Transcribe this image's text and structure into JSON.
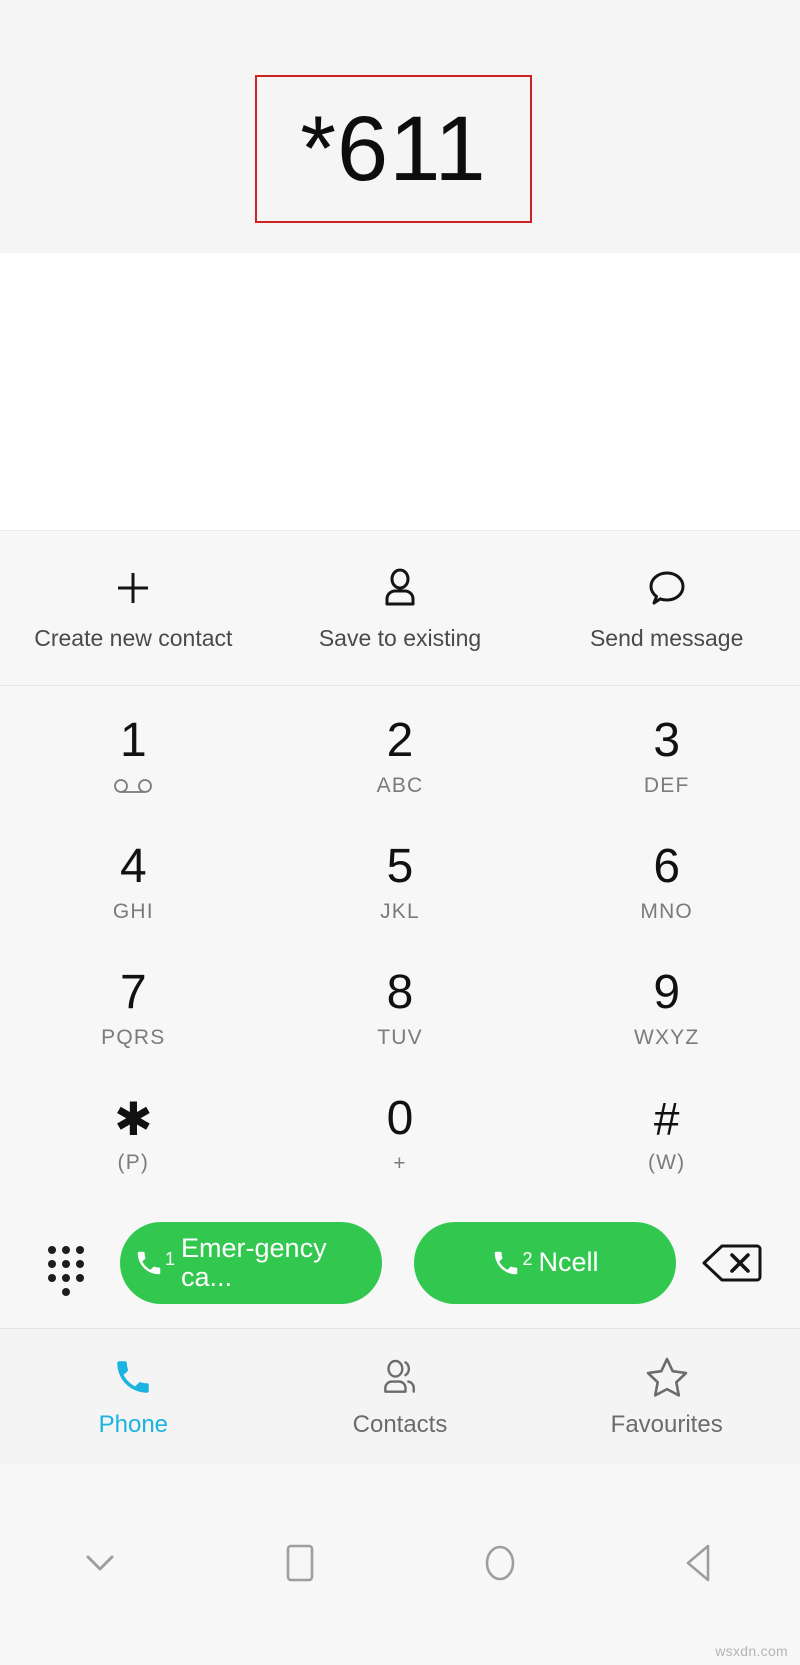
{
  "header": {
    "dialed_number": "*611",
    "highlight_color": "#cc2222",
    "background": "#f5f5f5"
  },
  "actions": [
    {
      "label": "Create new contact",
      "icon": "plus-icon"
    },
    {
      "label": "Save to existing",
      "icon": "person-icon"
    },
    {
      "label": "Send message",
      "icon": "message-bubble-icon"
    }
  ],
  "keypad": {
    "rows": [
      [
        {
          "digit": "1",
          "sub": "",
          "icon": "voicemail-icon"
        },
        {
          "digit": "2",
          "sub": "ABC",
          "icon": ""
        },
        {
          "digit": "3",
          "sub": "DEF",
          "icon": ""
        }
      ],
      [
        {
          "digit": "4",
          "sub": "GHI",
          "icon": ""
        },
        {
          "digit": "5",
          "sub": "JKL",
          "icon": ""
        },
        {
          "digit": "6",
          "sub": "MNO",
          "icon": ""
        }
      ],
      [
        {
          "digit": "7",
          "sub": "PQRS",
          "icon": ""
        },
        {
          "digit": "8",
          "sub": "TUV",
          "icon": ""
        },
        {
          "digit": "9",
          "sub": "WXYZ",
          "icon": ""
        }
      ],
      [
        {
          "digit": "✱",
          "sub": "(P)",
          "icon": ""
        },
        {
          "digit": "0",
          "sub": "+",
          "icon": ""
        },
        {
          "digit": "#",
          "sub": "(W)",
          "icon": ""
        }
      ]
    ]
  },
  "call_bar": {
    "dialpad_toggle_icon": "dialpad-icon",
    "backspace_icon": "backspace-icon",
    "button_color": "#32c850",
    "buttons": [
      {
        "sim": "1",
        "label": "Emer-gency ca...",
        "icon": "phone-icon"
      },
      {
        "sim": "2",
        "label": "Ncell",
        "icon": "phone-icon"
      }
    ]
  },
  "tabbar": {
    "active_color": "#1bb3e0",
    "tabs": [
      {
        "label": "Phone",
        "icon": "phone-icon",
        "active": true
      },
      {
        "label": "Contacts",
        "icon": "people-icon",
        "active": false
      },
      {
        "label": "Favourites",
        "icon": "star-icon",
        "active": false
      }
    ]
  },
  "navbar": {
    "items": [
      {
        "icon": "chevron-down-icon",
        "name": "hide-keyboard"
      },
      {
        "icon": "square-icon",
        "name": "recents"
      },
      {
        "icon": "circle-icon",
        "name": "home"
      },
      {
        "icon": "triangle-left-icon",
        "name": "back"
      }
    ],
    "watermark": "wsxdn.com"
  }
}
